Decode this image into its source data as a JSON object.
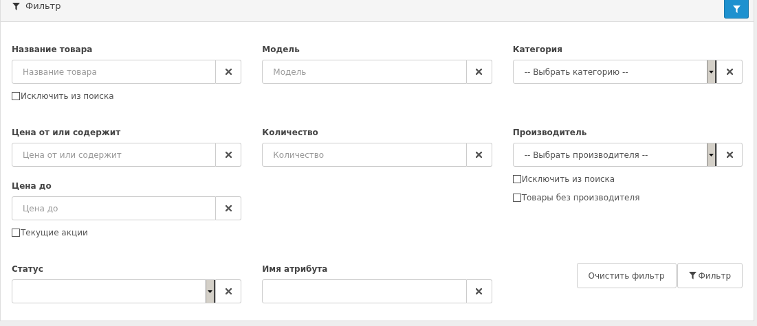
{
  "header": {
    "title": "Фильтр"
  },
  "rows": [
    {
      "columns": [
        [
          {
            "kind": "label",
            "text": "Название товара"
          },
          {
            "kind": "input",
            "placeholder": "Название товара"
          },
          {
            "kind": "checkbox",
            "label": "Исключить из поиска",
            "checked": false
          }
        ],
        [
          {
            "kind": "label",
            "text": "Модель"
          },
          {
            "kind": "input",
            "placeholder": "Модель"
          }
        ],
        [
          {
            "kind": "label",
            "text": "Категория"
          },
          {
            "kind": "select",
            "value": "-- Выбрать категорию --"
          }
        ]
      ]
    },
    {
      "columns": [
        [
          {
            "kind": "label",
            "text": "Цена от или содержит"
          },
          {
            "kind": "input",
            "placeholder": "Цена от или содержит"
          },
          {
            "kind": "gap"
          },
          {
            "kind": "label",
            "text": "Цена до"
          },
          {
            "kind": "input",
            "placeholder": "Цена до"
          },
          {
            "kind": "checkbox",
            "label": "Текущие акции",
            "checked": false
          }
        ],
        [
          {
            "kind": "label",
            "text": "Количество"
          },
          {
            "kind": "input",
            "placeholder": "Количество"
          }
        ],
        [
          {
            "kind": "label",
            "text": "Производитель"
          },
          {
            "kind": "select",
            "value": "-- Выбрать производителя --"
          },
          {
            "kind": "checkbox",
            "label": "Исключить из поиска",
            "checked": false
          },
          {
            "kind": "checkbox",
            "label": "Товары без производителя",
            "checked": false
          }
        ]
      ]
    },
    {
      "columns": [
        [
          {
            "kind": "label",
            "text": "Статус"
          },
          {
            "kind": "select"
          }
        ],
        [
          {
            "kind": "label",
            "text": "Имя атрибута"
          },
          {
            "kind": "input"
          }
        ],
        [
          {
            "kind": "buttons",
            "buttons": [
              {
                "label": "Очистить фильтр",
                "kind": "plain"
              },
              {
                "label": "Фильтр",
                "kind": "with-icon"
              }
            ]
          }
        ]
      ]
    }
  ]
}
